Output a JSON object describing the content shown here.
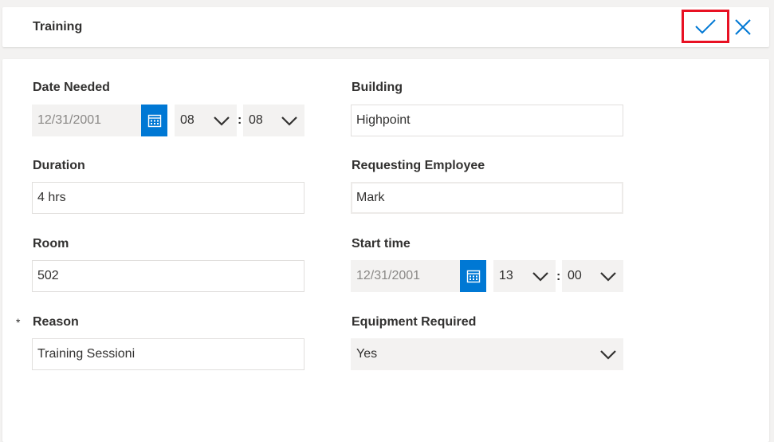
{
  "header": {
    "title": "Training",
    "confirm_icon": "check-icon",
    "close_icon": "close-icon"
  },
  "colors": {
    "accent": "#0078d4",
    "highlight": "#e81123",
    "field_bg": "#f3f2f1"
  },
  "form": {
    "date_needed": {
      "label": "Date Needed",
      "date": "12/31/2001",
      "hour": "08",
      "separator": ":",
      "minute": "08"
    },
    "building": {
      "label": "Building",
      "value": "Highpoint"
    },
    "duration": {
      "label": "Duration",
      "value": "4 hrs"
    },
    "requesting_employee": {
      "label": "Requesting Employee",
      "value": "Mark"
    },
    "room": {
      "label": "Room",
      "value": "502"
    },
    "start_time": {
      "label": "Start time",
      "date": "12/31/2001",
      "hour": "13",
      "separator": ":",
      "minute": "00"
    },
    "reason": {
      "required_mark": "*",
      "label": "Reason",
      "value": "Training Sessioni"
    },
    "equipment_required": {
      "label": "Equipment Required",
      "value": "Yes"
    }
  }
}
